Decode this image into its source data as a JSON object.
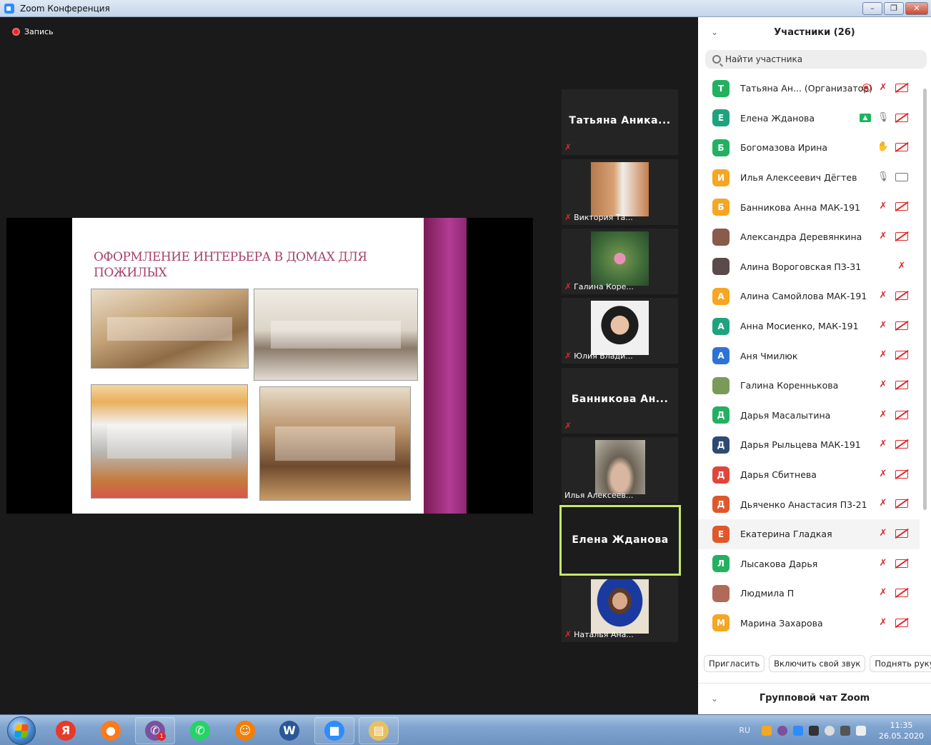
{
  "window": {
    "title": "Zoom Конференция",
    "minimize": "–",
    "restore": "❐",
    "close": "✕"
  },
  "recording": {
    "label": "Запись"
  },
  "slide": {
    "title": "ОФОРМЛЕНИЕ ИНТЕРЬЕРА В ДОМАХ ДЛЯ ПОЖИЛЫХ"
  },
  "thumbnails": [
    {
      "name": "Татьяна Аника...",
      "type": "name",
      "mute_icon": "muted-mic-icon"
    },
    {
      "name": "Виктория Та...",
      "type": "video",
      "mute_icon": "muted-mic-icon"
    },
    {
      "name": "Галина Коре...",
      "type": "video",
      "mute_icon": "muted-mic-icon"
    },
    {
      "name": "Юлия Влади...",
      "type": "video",
      "mute_icon": "muted-mic-icon"
    },
    {
      "name": "Банникова Ан...",
      "type": "name",
      "mute_icon": "muted-mic-icon"
    },
    {
      "name": "Илья Алексеев...",
      "type": "video"
    },
    {
      "name": "Елена Жданова",
      "type": "active"
    },
    {
      "name": "Наталья Ана...",
      "type": "video",
      "mute_icon": "muted-mic-icon"
    }
  ],
  "participants_panel": {
    "title": "Участники (26)",
    "search_placeholder": "Найти участника",
    "participants": [
      {
        "initial": "Т",
        "color": "#23b061",
        "name": "Татьяна Ан...  (Организатор)",
        "icons": [
          "recording-icon",
          "muted-mic-icon",
          "video-off-icon"
        ]
      },
      {
        "initial": "Е",
        "color": "#1fa37f",
        "name": "Елена Жданова",
        "icons": [
          "share-screen-icon",
          "mic-icon",
          "video-off-icon"
        ]
      },
      {
        "initial": "Б",
        "color": "#23b061",
        "name": "Богомазова Ирина",
        "icons": [
          "raise-hand-icon",
          "video-off-icon"
        ]
      },
      {
        "initial": "И",
        "color": "#f5a623",
        "name": "Илья Алексеевич Дёгтев",
        "icons": [
          "mic-icon",
          "video-on-icon"
        ]
      },
      {
        "initial": "Б",
        "color": "#f5a623",
        "name": " Банникова Анна МАК-191",
        "icons": [
          "muted-mic-icon",
          "video-off-icon"
        ]
      },
      {
        "initial": "",
        "color": "#8a5a4a",
        "name": "Александра Деревянкина",
        "icons": [
          "muted-mic-icon",
          "video-off-icon"
        ]
      },
      {
        "initial": "",
        "color": "#5a4a4a",
        "name": "Алина Вороговская П3-31",
        "icons": [
          "muted-mic-icon"
        ]
      },
      {
        "initial": "А",
        "color": "#f5a623",
        "name": "Алина Самойлова МАК-191",
        "icons": [
          "muted-mic-icon",
          "video-off-icon"
        ]
      },
      {
        "initial": "А",
        "color": "#1fa37f",
        "name": "Анна Мосиенко, МАК-191",
        "icons": [
          "muted-mic-icon",
          "video-off-icon"
        ]
      },
      {
        "initial": "А",
        "color": "#2d73d6",
        "name": "Аня Чмилюк",
        "icons": [
          "muted-mic-icon",
          "video-off-icon"
        ]
      },
      {
        "initial": "",
        "color": "#7a9a5a",
        "name": "Галина Кореннькова",
        "icons": [
          "muted-mic-icon",
          "video-off-icon"
        ]
      },
      {
        "initial": "Д",
        "color": "#23b061",
        "name": "Дарья Масалытина",
        "icons": [
          "muted-mic-icon",
          "video-off-icon"
        ]
      },
      {
        "initial": "Д",
        "color": "#2d4a73",
        "name": "Дарья Рыльцева МАК-191",
        "icons": [
          "muted-mic-icon",
          "video-off-icon"
        ]
      },
      {
        "initial": "Д",
        "color": "#e0453a",
        "name": "Дарья Сбитнева",
        "icons": [
          "muted-mic-icon",
          "video-off-icon"
        ]
      },
      {
        "initial": "Д",
        "color": "#e0572a",
        "name": "Дьяченко Анастасия П3-21",
        "icons": [
          "muted-mic-icon",
          "video-off-icon"
        ]
      },
      {
        "initial": "Е",
        "color": "#e0572a",
        "name": "Екатерина Гладкая",
        "icons": [
          "muted-mic-icon",
          "video-off-icon"
        ]
      },
      {
        "initial": "Л",
        "color": "#23b061",
        "name": "Лысакова Дарья",
        "icons": [
          "muted-mic-icon",
          "video-off-icon"
        ]
      },
      {
        "initial": "",
        "color": "#b06a5a",
        "name": "Людмила П",
        "icons": [
          "muted-mic-icon",
          "video-off-icon"
        ]
      },
      {
        "initial": "М",
        "color": "#f5a623",
        "name": "Марина Захарова",
        "icons": [
          "muted-mic-icon",
          "video-off-icon"
        ]
      }
    ],
    "buttons": {
      "invite": "Пригласить",
      "unmute": "Включить свой звук",
      "raise_hand": "Поднять руку"
    },
    "chat_title": "Групповой чат Zoom"
  },
  "taskbar": {
    "apps": [
      {
        "name": "yandex-browser-icon",
        "glyph": "Я",
        "color": "#e63a2a"
      },
      {
        "name": "firefox-icon",
        "glyph": "●",
        "color": "#ff7a1a"
      },
      {
        "name": "viber-icon",
        "glyph": "✆",
        "color": "#7b519d",
        "badge": "1"
      },
      {
        "name": "whatsapp-icon",
        "glyph": "✆",
        "color": "#25d366"
      },
      {
        "name": "ok-icon",
        "glyph": "☺",
        "color": "#f57d00"
      },
      {
        "name": "word-icon",
        "glyph": "W",
        "color": "#2b5797"
      },
      {
        "name": "zoom-icon",
        "glyph": "■",
        "color": "#2d8cff"
      },
      {
        "name": "explorer-icon",
        "glyph": "▤",
        "color": "#e8c060"
      }
    ],
    "lang": "RU",
    "time": "11:35",
    "date": "26.05.2020"
  }
}
